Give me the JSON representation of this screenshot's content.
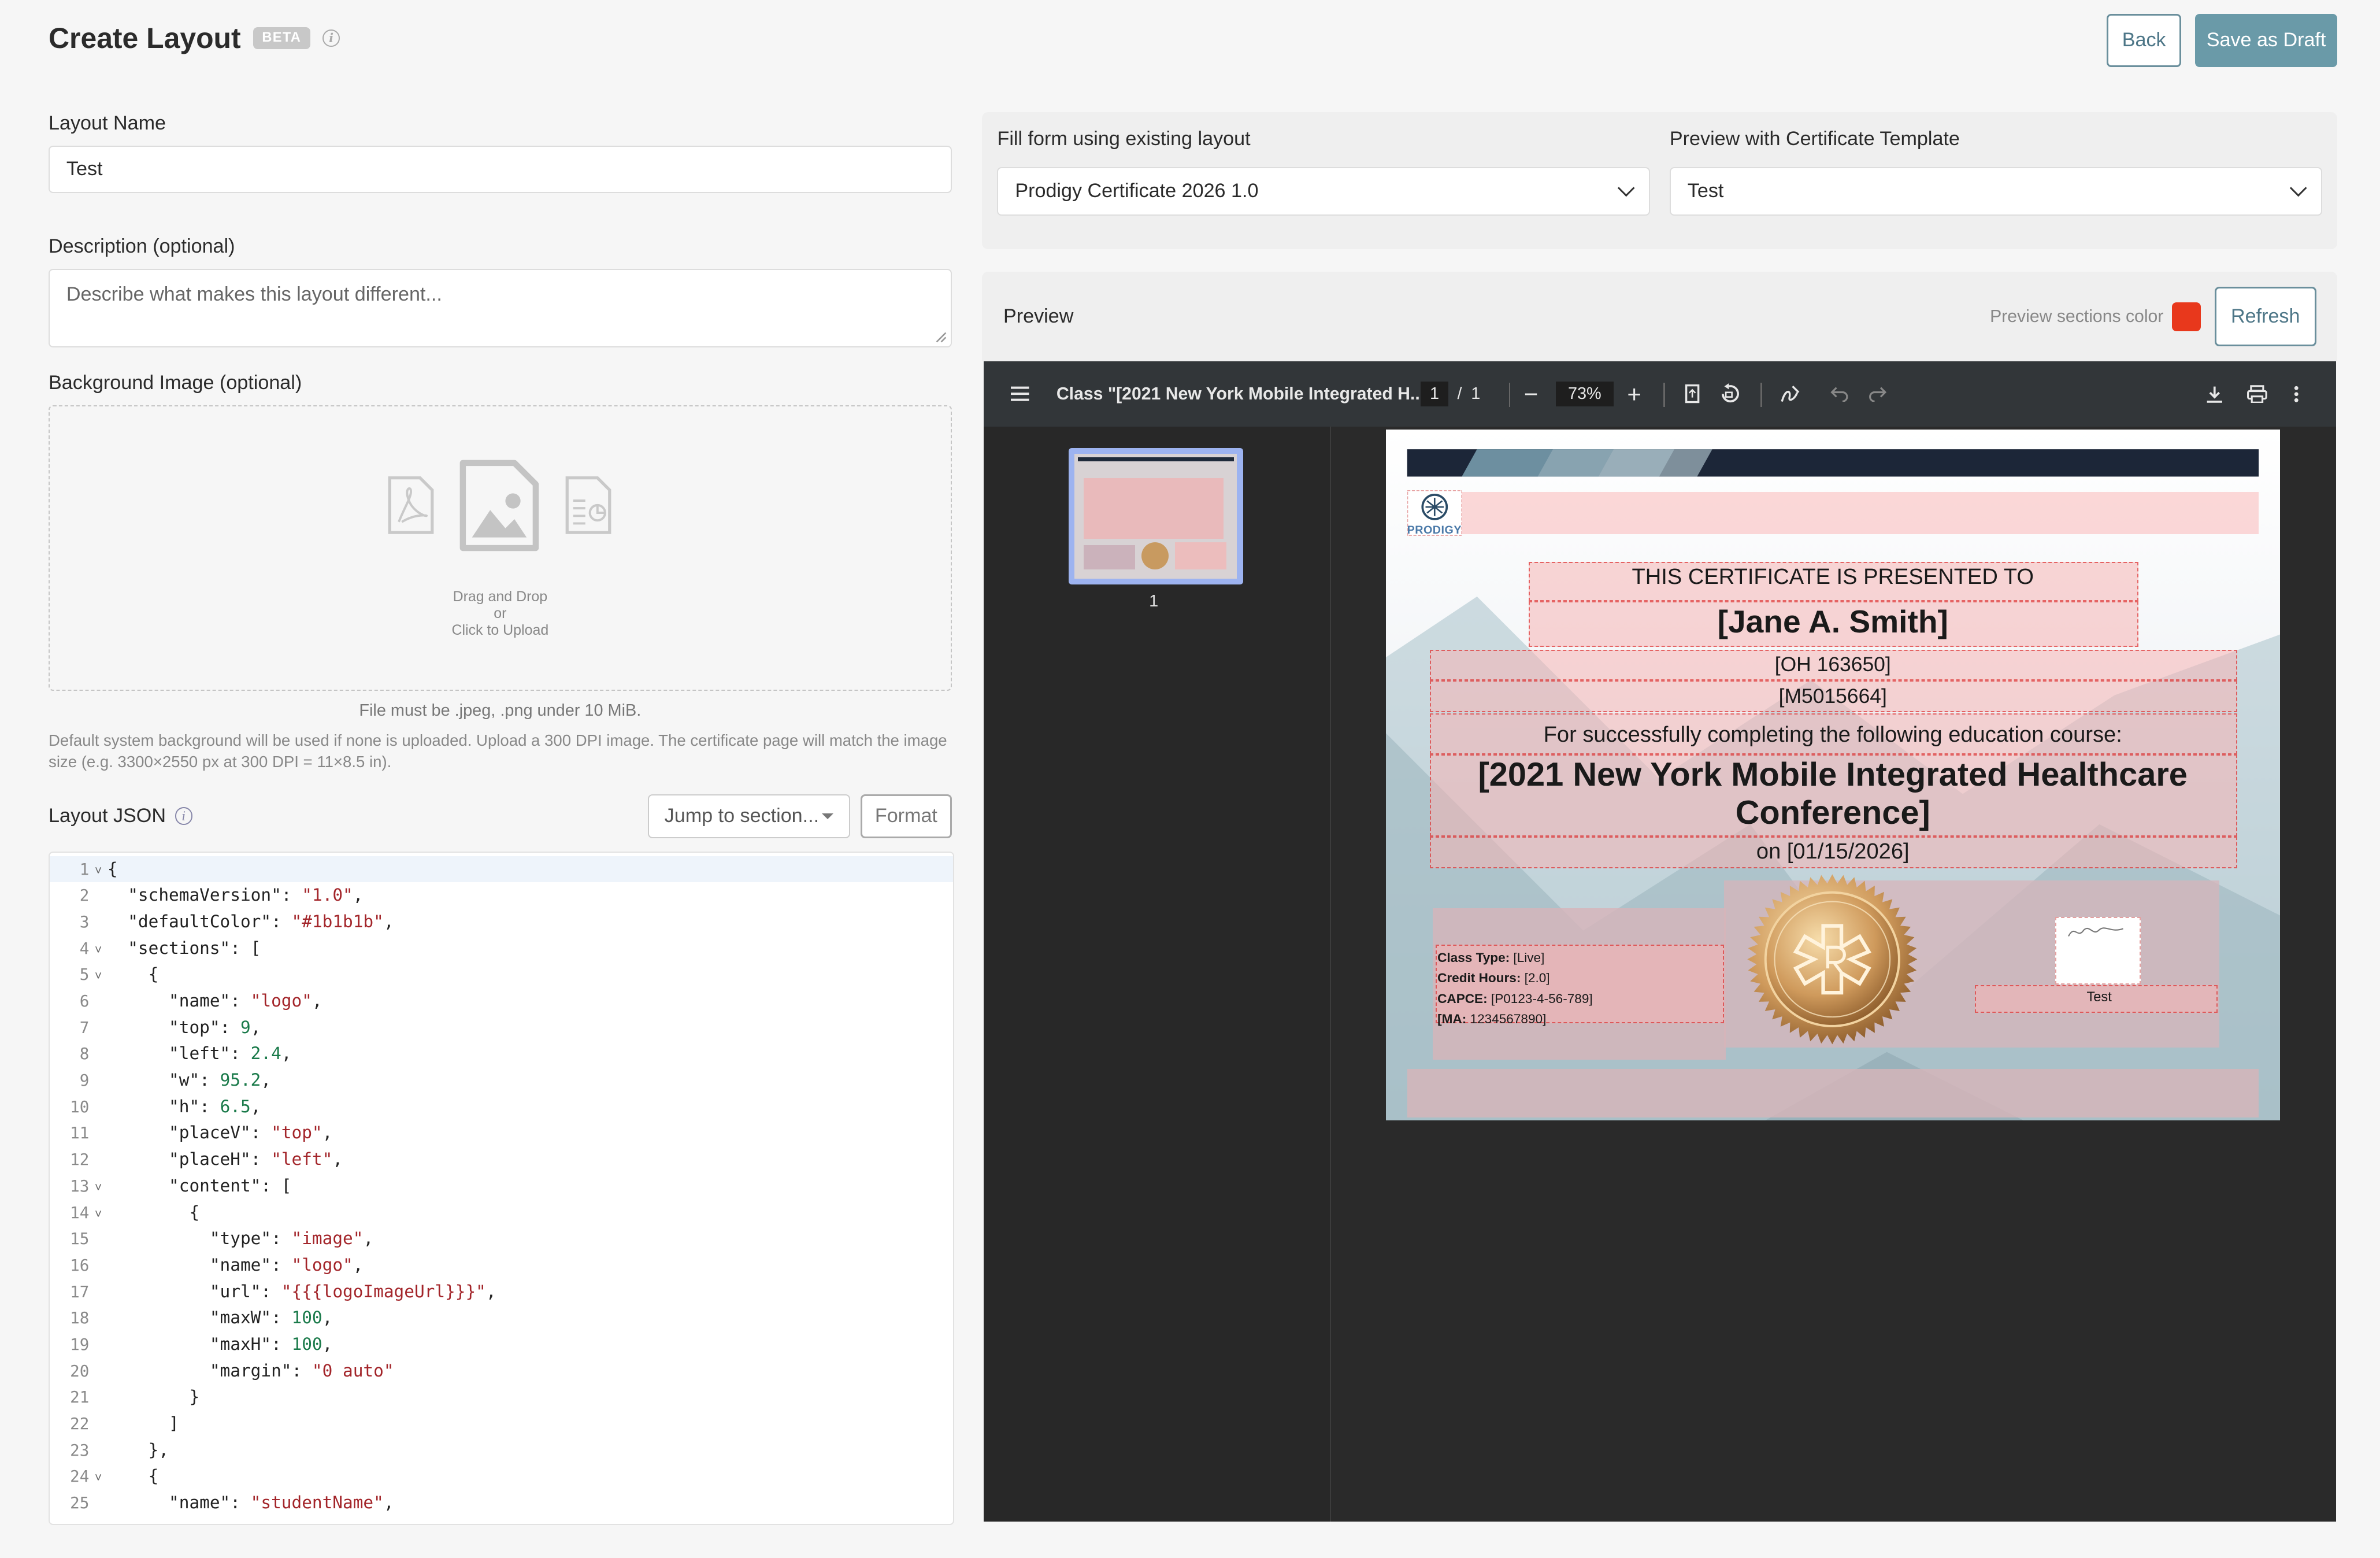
{
  "header": {
    "title": "Create Layout",
    "beta": "BETA",
    "back_label": "Back",
    "save_draft_label": "Save as Draft"
  },
  "form": {
    "layout_name_label": "Layout Name",
    "layout_name_value": "Test",
    "description_label": "Description (optional)",
    "description_placeholder": "Describe what makes this layout different...",
    "background_label": "Background Image (optional)",
    "drop_line1": "Drag and Drop",
    "drop_line2": "or",
    "drop_line3": "Click to Upload",
    "file_note": "File must be .jpeg, .png under 10 MiB.",
    "default_note": "Default system background will be used if none is uploaded. Upload a 300 DPI image. The certificate page will match the image size (e.g. 3300×2550 px at 300 DPI = 11×8.5 in).",
    "json_label": "Layout JSON",
    "jump_label": "Jump to section...",
    "format_label": "Format"
  },
  "editor_lines": [
    {
      "n": "1",
      "fold": true,
      "t": [
        [
          "c",
          "{"
        ]
      ]
    },
    {
      "n": "2",
      "t": [
        [
          "c",
          "  \"schemaVersion\": "
        ],
        [
          "s",
          "\"1.0\""
        ],
        [
          "c",
          ","
        ]
      ]
    },
    {
      "n": "3",
      "t": [
        [
          "c",
          "  \"defaultColor\": "
        ],
        [
          "s",
          "\"#1b1b1b\""
        ],
        [
          "c",
          ","
        ]
      ]
    },
    {
      "n": "4",
      "fold": true,
      "t": [
        [
          "c",
          "  \"sections\": ["
        ]
      ]
    },
    {
      "n": "5",
      "fold": true,
      "t": [
        [
          "c",
          "    {"
        ]
      ]
    },
    {
      "n": "6",
      "t": [
        [
          "c",
          "      \"name\": "
        ],
        [
          "s",
          "\"logo\""
        ],
        [
          "c",
          ","
        ]
      ]
    },
    {
      "n": "7",
      "t": [
        [
          "c",
          "      \"top\": "
        ],
        [
          "n",
          "9"
        ],
        [
          "c",
          ","
        ]
      ]
    },
    {
      "n": "8",
      "t": [
        [
          "c",
          "      \"left\": "
        ],
        [
          "n",
          "2.4"
        ],
        [
          "c",
          ","
        ]
      ]
    },
    {
      "n": "9",
      "t": [
        [
          "c",
          "      \"w\": "
        ],
        [
          "n",
          "95.2"
        ],
        [
          "c",
          ","
        ]
      ]
    },
    {
      "n": "10",
      "t": [
        [
          "c",
          "      \"h\": "
        ],
        [
          "n",
          "6.5"
        ],
        [
          "c",
          ","
        ]
      ]
    },
    {
      "n": "11",
      "t": [
        [
          "c",
          "      \"placeV\": "
        ],
        [
          "s",
          "\"top\""
        ],
        [
          "c",
          ","
        ]
      ]
    },
    {
      "n": "12",
      "t": [
        [
          "c",
          "      \"placeH\": "
        ],
        [
          "s",
          "\"left\""
        ],
        [
          "c",
          ","
        ]
      ]
    },
    {
      "n": "13",
      "fold": true,
      "t": [
        [
          "c",
          "      \"content\": ["
        ]
      ]
    },
    {
      "n": "14",
      "fold": true,
      "t": [
        [
          "c",
          "        {"
        ]
      ]
    },
    {
      "n": "15",
      "t": [
        [
          "c",
          "          \"type\": "
        ],
        [
          "s",
          "\"image\""
        ],
        [
          "c",
          ","
        ]
      ]
    },
    {
      "n": "16",
      "t": [
        [
          "c",
          "          \"name\": "
        ],
        [
          "s",
          "\"logo\""
        ],
        [
          "c",
          ","
        ]
      ]
    },
    {
      "n": "17",
      "t": [
        [
          "c",
          "          \"url\": "
        ],
        [
          "s",
          "\"{{{logoImageUrl}}}\""
        ],
        [
          "c",
          ","
        ]
      ]
    },
    {
      "n": "18",
      "t": [
        [
          "c",
          "          \"maxW\": "
        ],
        [
          "n",
          "100"
        ],
        [
          "c",
          ","
        ]
      ]
    },
    {
      "n": "19",
      "t": [
        [
          "c",
          "          \"maxH\": "
        ],
        [
          "n",
          "100"
        ],
        [
          "c",
          ","
        ]
      ]
    },
    {
      "n": "20",
      "t": [
        [
          "c",
          "          \"margin\": "
        ],
        [
          "s",
          "\"0 auto\""
        ]
      ]
    },
    {
      "n": "21",
      "t": [
        [
          "c",
          "        }"
        ]
      ]
    },
    {
      "n": "22",
      "t": [
        [
          "c",
          "      ]"
        ]
      ]
    },
    {
      "n": "23",
      "t": [
        [
          "c",
          "    },"
        ]
      ]
    },
    {
      "n": "24",
      "fold": true,
      "t": [
        [
          "c",
          "    {"
        ]
      ]
    },
    {
      "n": "25",
      "t": [
        [
          "c",
          "      \"name\": "
        ],
        [
          "s",
          "\"studentName\""
        ],
        [
          "c",
          ","
        ]
      ]
    }
  ],
  "fill": {
    "existing_label": "Fill form using existing layout",
    "existing_value": "Prodigy Certificate 2026 1.0",
    "template_label": "Preview with Certificate Template",
    "template_value": "Test"
  },
  "preview": {
    "title": "Preview",
    "color_label": "Preview sections color",
    "color": "#e8381c",
    "refresh_label": "Refresh"
  },
  "pdf": {
    "doc_title": "Class \"[2021 New York Mobile Integrated H...",
    "page_current": "1",
    "page_sep": "/",
    "page_total": "1",
    "zoom": "73%",
    "thumb_label": "1"
  },
  "certificate": {
    "logo_text": "PRODIGY",
    "presented": "THIS CERTIFICATE IS PRESENTED TO",
    "name": "[Jane A. Smith]",
    "license1": "[OH 163650]",
    "license2": "[M5015664]",
    "completing": "For successfully completing the following education course:",
    "course_line1": "[2021 New York Mobile Integrated Healthcare",
    "course_line2": "Conference]",
    "date": "on [01/15/2026]",
    "details": [
      {
        "k": "Class Type:",
        "v": "[Live]"
      },
      {
        "k": "Credit Hours:",
        "v": "[2.0]"
      },
      {
        "k": "CAPCE:",
        "v": "[P0123-4-56-789]"
      },
      {
        "k": "[MA:",
        "v": "1234567890]"
      }
    ],
    "signature_name": "Test"
  },
  "colors": {
    "accent": "#6a9aa8",
    "viewer_bg": "#2a2a2a",
    "toolbar_bg": "#323639"
  }
}
